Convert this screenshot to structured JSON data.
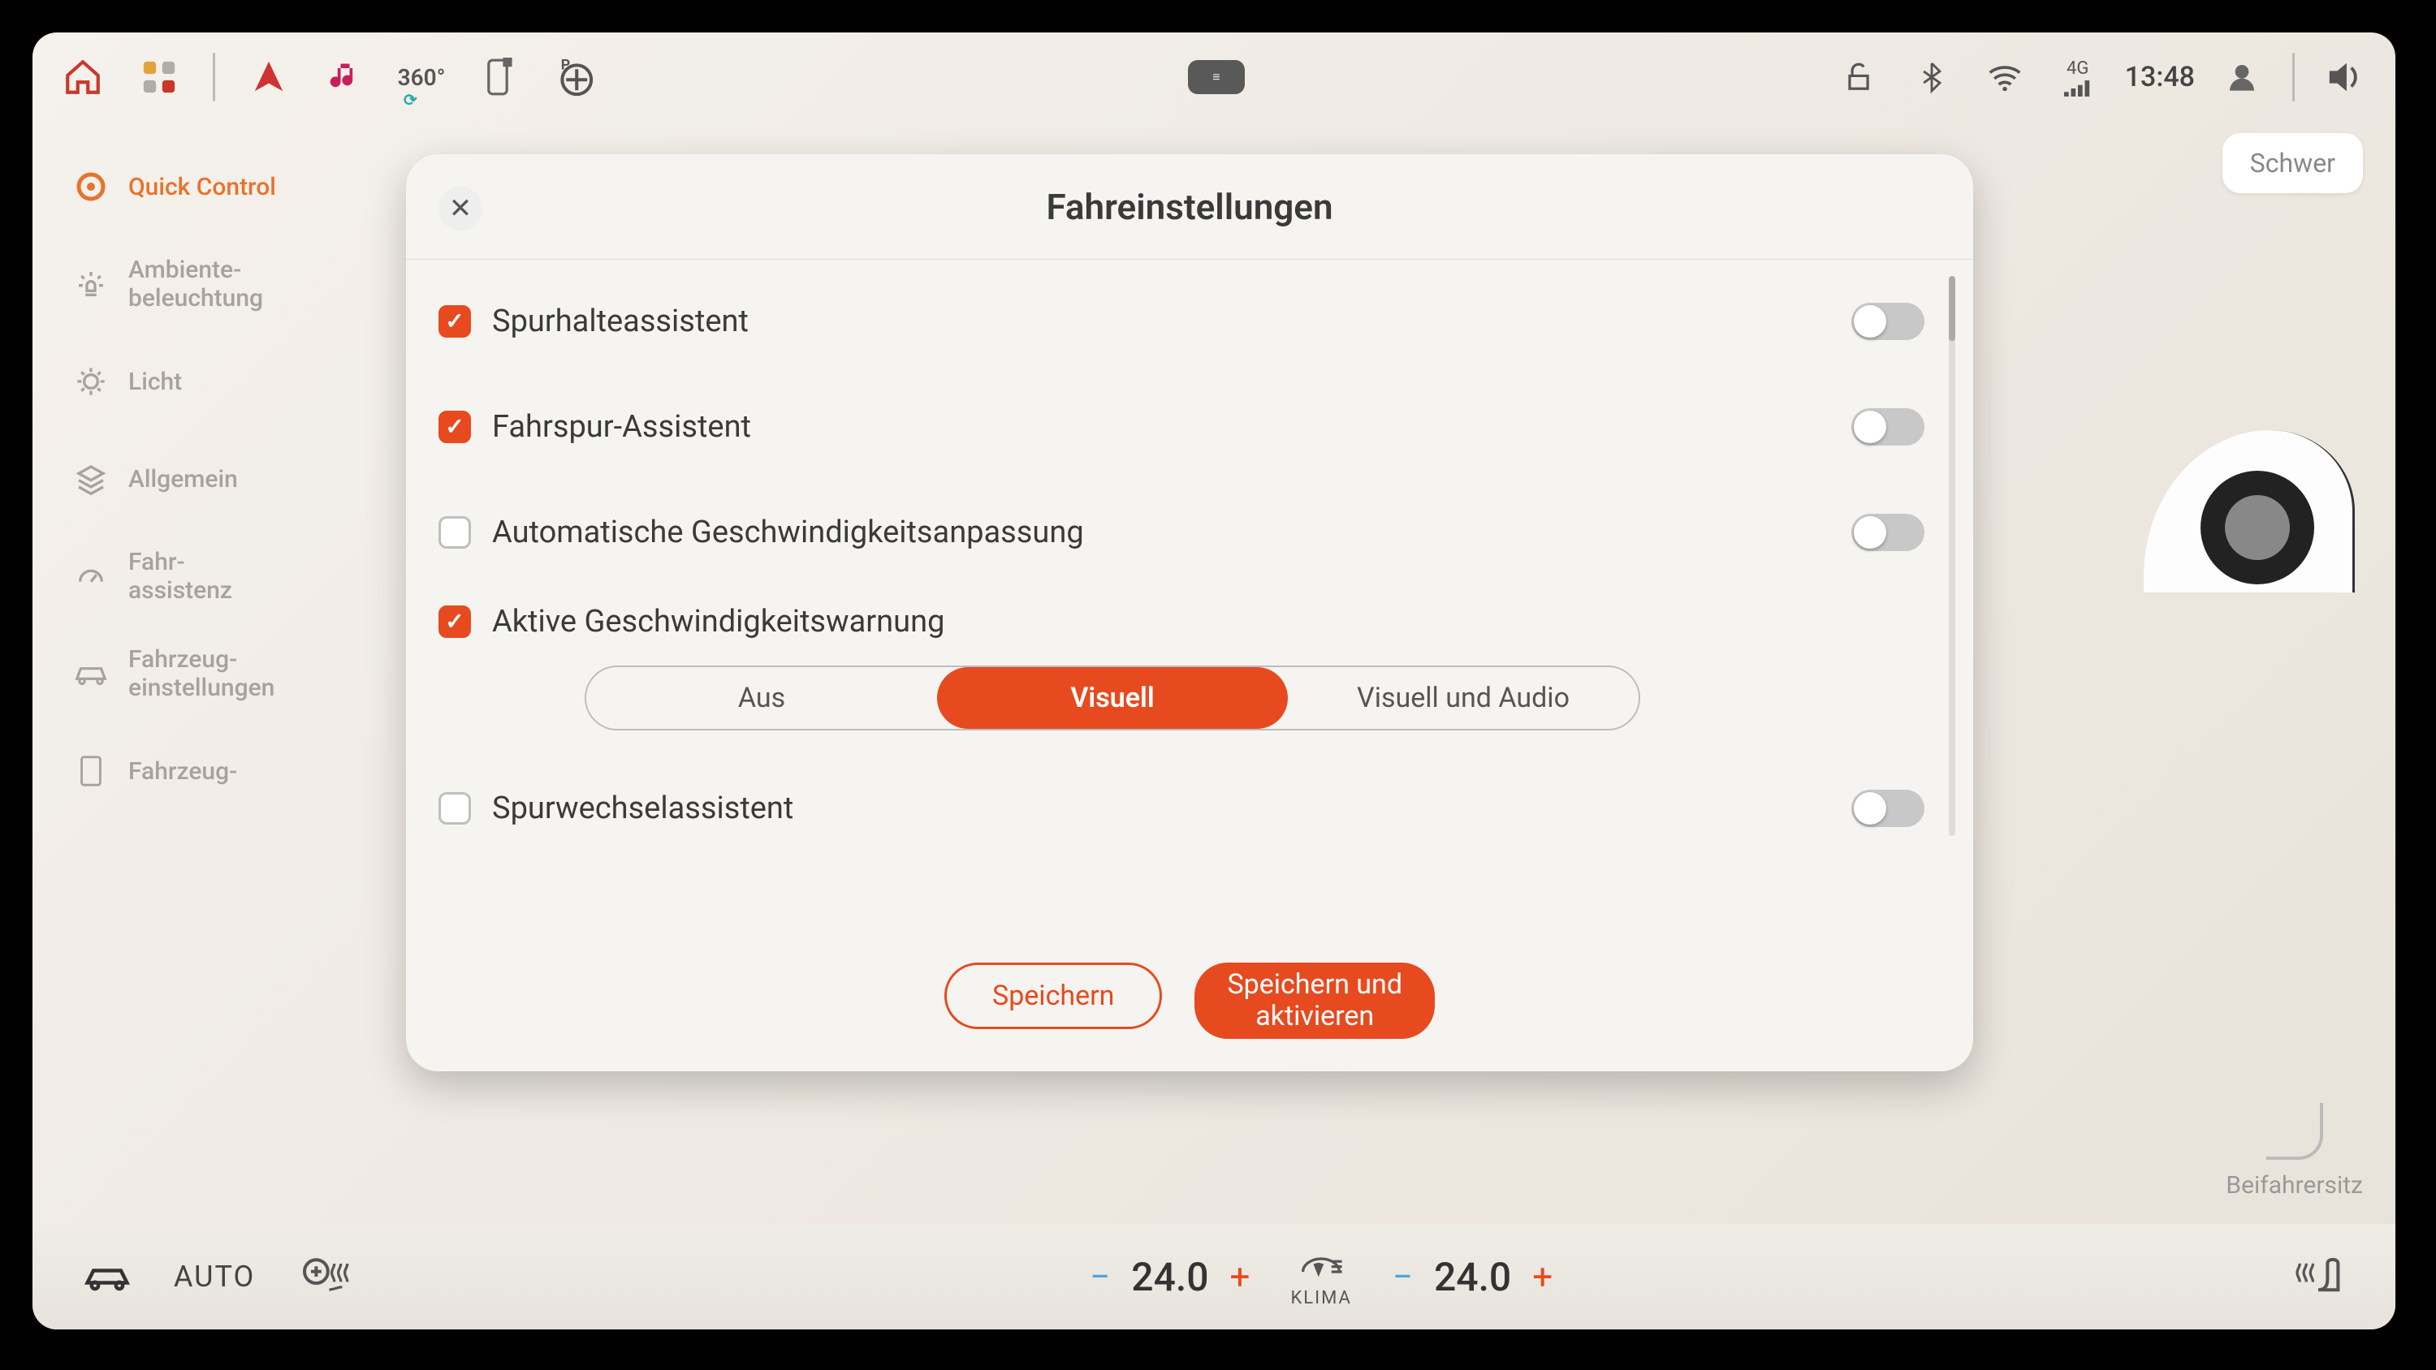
{
  "topbar": {
    "surround_label": "360°",
    "network_label": "4G",
    "clock": "13:48"
  },
  "sidebar": {
    "items": [
      {
        "label": "Quick Control"
      },
      {
        "label": "Ambiente-\nbeleuchtung"
      },
      {
        "label": "Licht"
      },
      {
        "label": "Allgemein"
      },
      {
        "label": "Fahr-\nassistenz"
      },
      {
        "label": "Fahrzeug-\neinstellungen"
      },
      {
        "label": "Fahrzeug-"
      }
    ]
  },
  "background": {
    "card_label": "Schwer",
    "right_bottom_label": "Beifahrersitz"
  },
  "modal": {
    "title": "Fahreinstellungen",
    "rows": [
      {
        "label": "Spurhalteassistent",
        "checked": true,
        "toggle_on": false
      },
      {
        "label": "Fahrspur-Assistent",
        "checked": true,
        "toggle_on": false
      },
      {
        "label": "Automatische Geschwindigkeitsanpassung",
        "checked": false,
        "toggle_on": false
      },
      {
        "label": "Aktive Geschwindigkeitswarnung",
        "checked": true
      },
      {
        "label": "Spurwechselassistent",
        "checked": false,
        "toggle_on": false
      }
    ],
    "segmented": {
      "options": [
        "Aus",
        "Visuell",
        "Visuell und Audio"
      ],
      "selected_index": 1
    },
    "footer": {
      "save": "Speichern",
      "save_activate": "Speichern und\naktivieren"
    }
  },
  "climate": {
    "auto_label": "AUTO",
    "left_temp": "24.0",
    "right_temp": "24.0",
    "klima_label": "KLIMA"
  }
}
